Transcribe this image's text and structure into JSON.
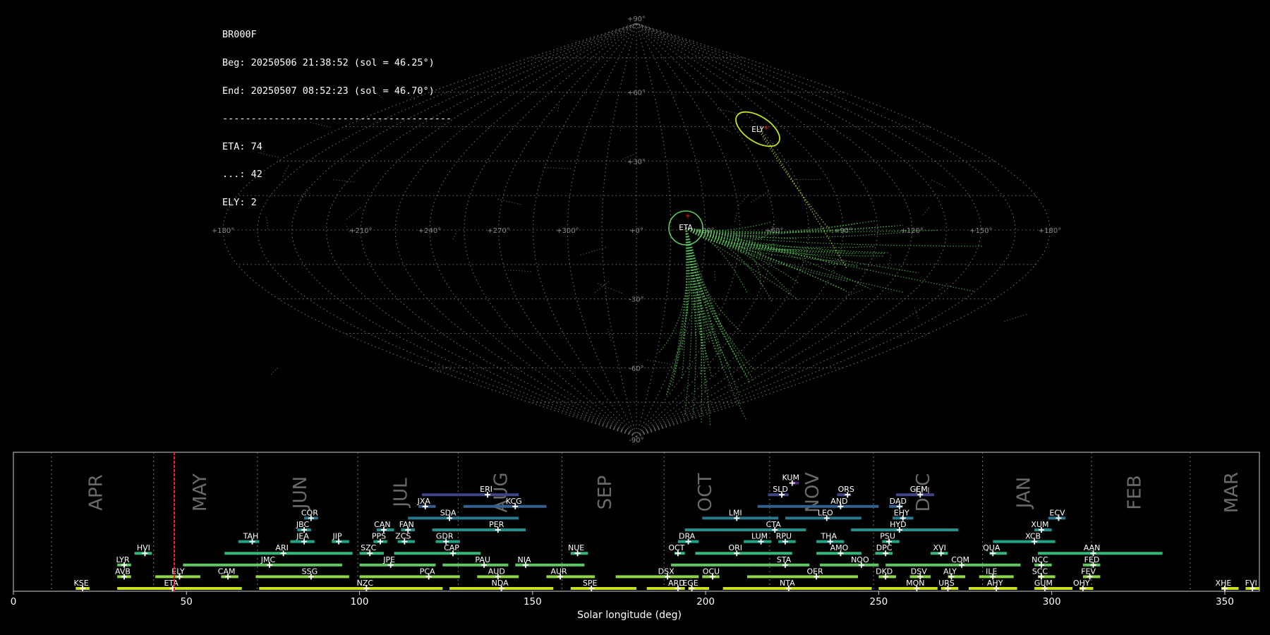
{
  "info": {
    "station": "BR000F",
    "beg": "Beg: 20250506 21:38:52 (sol = 46.25°)",
    "end": "End: 20250507 08:52:23 (sol = 46.70°)",
    "separator": "----------------------------------------",
    "counts": [
      "ETA: 74",
      "...: 42",
      "ELY: 2"
    ]
  },
  "sky_map": {
    "projection": "sinusoidal",
    "lat_labels": [
      "+90°",
      "+60°",
      "+30°",
      "-30°",
      "-60°",
      "-90°"
    ],
    "lon_labels": [
      "+180°",
      "+150°",
      "+120°",
      "+90°",
      "+60°",
      "+30°",
      "+0°",
      "+300°",
      "+270°",
      "+240°",
      "+210°",
      "+180°"
    ],
    "radiants": [
      {
        "name": "ETA",
        "color": "#5ec962",
        "count": 74
      },
      {
        "name": "ELY",
        "color": "#c8e020",
        "count": 2
      }
    ]
  },
  "chart_data": {
    "type": "scatter",
    "xlabel": "Solar longitude (deg)",
    "xlim": [
      0,
      360
    ],
    "xticks": [
      0,
      50,
      100,
      150,
      200,
      250,
      300,
      350
    ],
    "current_sol": 46.48,
    "months": [
      {
        "name": "APR",
        "x": 24
      },
      {
        "name": "MAY",
        "x": 54
      },
      {
        "name": "JUN",
        "x": 83
      },
      {
        "name": "JUL",
        "x": 112
      },
      {
        "name": "AUG",
        "x": 141
      },
      {
        "name": "SEP",
        "x": 171
      },
      {
        "name": "OCT",
        "x": 200
      },
      {
        "name": "NOV",
        "x": 231
      },
      {
        "name": "DEC",
        "x": 263
      },
      {
        "name": "JAN",
        "x": 292
      },
      {
        "name": "FEB",
        "x": 324
      },
      {
        "name": "MAR",
        "x": 352
      }
    ],
    "month_dividers": [
      11,
      40.5,
      70.5,
      99.5,
      128.5,
      158.5,
      188,
      218.5,
      248.5,
      280,
      311.5,
      340
    ],
    "showers": [
      {
        "code": "KUM",
        "start": 225,
        "end": 227,
        "peak": 225,
        "row": 10
      },
      {
        "code": "ERI",
        "start": 118,
        "end": 146,
        "peak": 137,
        "row": 9
      },
      {
        "code": "SLD",
        "start": 218,
        "end": 224,
        "peak": 222,
        "row": 9
      },
      {
        "code": "ORS",
        "start": 238,
        "end": 242,
        "peak": 241,
        "row": 9
      },
      {
        "code": "GEM",
        "start": 255,
        "end": 266,
        "peak": 262,
        "row": 9
      },
      {
        "code": "JXA",
        "start": 117,
        "end": 122,
        "peak": 119,
        "row": 8
      },
      {
        "code": "KCG",
        "start": 130,
        "end": 154,
        "peak": 145,
        "row": 8
      },
      {
        "code": "AND",
        "start": 215,
        "end": 250,
        "peak": 239,
        "row": 8
      },
      {
        "code": "DAD",
        "start": 253,
        "end": 257,
        "peak": 256,
        "row": 8
      },
      {
        "code": "COR",
        "start": 84,
        "end": 88,
        "peak": 86,
        "row": 7
      },
      {
        "code": "SDA",
        "start": 114,
        "end": 146,
        "peak": 126,
        "row": 7
      },
      {
        "code": "LMI",
        "start": 199,
        "end": 221,
        "peak": 209,
        "row": 7
      },
      {
        "code": "LEO",
        "start": 223,
        "end": 245,
        "peak": 235,
        "row": 7
      },
      {
        "code": "EHY",
        "start": 254,
        "end": 260,
        "peak": 257,
        "row": 7
      },
      {
        "code": "ECV",
        "start": 299,
        "end": 304,
        "peak": 302,
        "row": 7
      },
      {
        "code": "JBC",
        "start": 82,
        "end": 86,
        "peak": 84,
        "row": 6
      },
      {
        "code": "CAN",
        "start": 105,
        "end": 110,
        "peak": 107,
        "row": 6
      },
      {
        "code": "FAN",
        "start": 112,
        "end": 116,
        "peak": 114,
        "row": 6
      },
      {
        "code": "PER",
        "start": 121,
        "end": 148,
        "peak": 140,
        "row": 6
      },
      {
        "code": "CTA",
        "start": 194,
        "end": 229,
        "peak": 220,
        "row": 6
      },
      {
        "code": "HYD",
        "start": 242,
        "end": 273,
        "peak": 256,
        "row": 6
      },
      {
        "code": "XUM",
        "start": 295,
        "end": 300,
        "peak": 297,
        "row": 6
      },
      {
        "code": "TAH",
        "start": 65,
        "end": 71,
        "peak": 69,
        "row": 5
      },
      {
        "code": "JEA",
        "start": 80,
        "end": 87,
        "peak": 84,
        "row": 5
      },
      {
        "code": "JIP",
        "start": 92,
        "end": 97,
        "peak": 94,
        "row": 5
      },
      {
        "code": "PPS",
        "start": 104,
        "end": 108,
        "peak": 106,
        "row": 5
      },
      {
        "code": "ZCS",
        "start": 111,
        "end": 116,
        "peak": 113,
        "row": 5
      },
      {
        "code": "GDR",
        "start": 122,
        "end": 129,
        "peak": 125,
        "row": 5
      },
      {
        "code": "DRA",
        "start": 192,
        "end": 198,
        "peak": 195,
        "row": 5
      },
      {
        "code": "LUM",
        "start": 211,
        "end": 219,
        "peak": 216,
        "row": 5
      },
      {
        "code": "RPU",
        "start": 221,
        "end": 226,
        "peak": 223,
        "row": 5
      },
      {
        "code": "THA",
        "start": 232,
        "end": 240,
        "peak": 236,
        "row": 5
      },
      {
        "code": "PSU",
        "start": 251,
        "end": 256,
        "peak": 253,
        "row": 5
      },
      {
        "code": "XCB",
        "start": 283,
        "end": 301,
        "peak": 295,
        "row": 5
      },
      {
        "code": "HVI",
        "start": 35,
        "end": 40,
        "peak": 38,
        "row": 4
      },
      {
        "code": "ARI",
        "start": 61,
        "end": 98,
        "peak": 78,
        "row": 4
      },
      {
        "code": "SZC",
        "start": 100,
        "end": 107,
        "peak": 103,
        "row": 4
      },
      {
        "code": "CAP",
        "start": 110,
        "end": 135,
        "peak": 127,
        "row": 4
      },
      {
        "code": "NUE",
        "start": 161,
        "end": 166,
        "peak": 163,
        "row": 4
      },
      {
        "code": "OCT",
        "start": 191,
        "end": 194,
        "peak": 192,
        "row": 4
      },
      {
        "code": "ORI",
        "start": 197,
        "end": 225,
        "peak": 209,
        "row": 4
      },
      {
        "code": "AMO",
        "start": 232,
        "end": 245,
        "peak": 239,
        "row": 4
      },
      {
        "code": "DPC",
        "start": 249,
        "end": 254,
        "peak": 252,
        "row": 4
      },
      {
        "code": "XVI",
        "start": 265,
        "end": 270,
        "peak": 268,
        "row": 4
      },
      {
        "code": "QUA",
        "start": 282,
        "end": 287,
        "peak": 283,
        "row": 4
      },
      {
        "code": "AAN",
        "start": 296,
        "end": 332,
        "peak": 312,
        "row": 4
      },
      {
        "code": "LYR",
        "start": 30,
        "end": 34,
        "peak": 32,
        "row": 3
      },
      {
        "code": "JMC",
        "start": 49,
        "end": 95,
        "peak": 74,
        "row": 3
      },
      {
        "code": "JPE",
        "start": 100,
        "end": 122,
        "peak": 109,
        "row": 3
      },
      {
        "code": "PAU",
        "start": 124,
        "end": 143,
        "peak": 136,
        "row": 3
      },
      {
        "code": "NIA",
        "start": 145,
        "end": 165,
        "peak": 148,
        "row": 3
      },
      {
        "code": "STA",
        "start": 190,
        "end": 230,
        "peak": 223,
        "row": 3
      },
      {
        "code": "NOO",
        "start": 233,
        "end": 250,
        "peak": 245,
        "row": 3
      },
      {
        "code": "COM",
        "start": 252,
        "end": 291,
        "peak": 274,
        "row": 3
      },
      {
        "code": "NCC",
        "start": 295,
        "end": 300,
        "peak": 297,
        "row": 3
      },
      {
        "code": "FED",
        "start": 309,
        "end": 314,
        "peak": 312,
        "row": 3
      },
      {
        "code": "AVB",
        "start": 30,
        "end": 34,
        "peak": 32,
        "row": 2
      },
      {
        "code": "ELY",
        "start": 41,
        "end": 54,
        "peak": 48,
        "row": 2
      },
      {
        "code": "CAM",
        "start": 60,
        "end": 65,
        "peak": 62,
        "row": 2
      },
      {
        "code": "SSG",
        "start": 70,
        "end": 97,
        "peak": 86,
        "row": 2
      },
      {
        "code": "PCA",
        "start": 100,
        "end": 129,
        "peak": 120,
        "row": 2
      },
      {
        "code": "AUD",
        "start": 134,
        "end": 146,
        "peak": 140,
        "row": 2
      },
      {
        "code": "AUR",
        "start": 154,
        "end": 168,
        "peak": 158,
        "row": 2
      },
      {
        "code": "DSX",
        "start": 174,
        "end": 198,
        "peak": 189,
        "row": 2
      },
      {
        "code": "OCU",
        "start": 199,
        "end": 204,
        "peak": 202,
        "row": 2
      },
      {
        "code": "OER",
        "start": 212,
        "end": 244,
        "peak": 232,
        "row": 2
      },
      {
        "code": "DKD",
        "start": 250,
        "end": 255,
        "peak": 252,
        "row": 2
      },
      {
        "code": "DSV",
        "start": 259,
        "end": 265,
        "peak": 262,
        "row": 2
      },
      {
        "code": "ALY",
        "start": 270,
        "end": 275,
        "peak": 271,
        "row": 2
      },
      {
        "code": "ILE",
        "start": 279,
        "end": 289,
        "peak": 283,
        "row": 2
      },
      {
        "code": "SCC",
        "start": 296,
        "end": 301,
        "peak": 297,
        "row": 2
      },
      {
        "code": "FEV",
        "start": 309,
        "end": 314,
        "peak": 311,
        "row": 2
      },
      {
        "code": "KSE",
        "start": 18,
        "end": 22,
        "peak": 20,
        "row": 1
      },
      {
        "code": "ETA",
        "start": 30,
        "end": 66,
        "peak": 46,
        "row": 1
      },
      {
        "code": "NZC",
        "start": 71,
        "end": 124,
        "peak": 102,
        "row": 1
      },
      {
        "code": "NDA",
        "start": 126,
        "end": 156,
        "peak": 141,
        "row": 1
      },
      {
        "code": "SPE",
        "start": 161,
        "end": 180,
        "peak": 167,
        "row": 1
      },
      {
        "code": "ARD",
        "start": 183,
        "end": 194,
        "peak": 192,
        "row": 1
      },
      {
        "code": "EGE",
        "start": 195,
        "end": 201,
        "peak": 196,
        "row": 1
      },
      {
        "code": "NTA",
        "start": 205,
        "end": 248,
        "peak": 224,
        "row": 1
      },
      {
        "code": "MON",
        "start": 250,
        "end": 267,
        "peak": 261,
        "row": 1
      },
      {
        "code": "URS",
        "start": 268,
        "end": 273,
        "peak": 270,
        "row": 1
      },
      {
        "code": "AHY",
        "start": 276,
        "end": 290,
        "peak": 284,
        "row": 1
      },
      {
        "code": "GUM",
        "start": 295,
        "end": 306,
        "peak": 298,
        "row": 1
      },
      {
        "code": "OHY",
        "start": 308,
        "end": 312,
        "peak": 309,
        "row": 1
      },
      {
        "code": "XHE",
        "start": 349,
        "end": 354,
        "peak": 350,
        "row": 1
      },
      {
        "code": "FVI",
        "start": 356,
        "end": 361,
        "peak": 358,
        "row": 1
      }
    ]
  }
}
